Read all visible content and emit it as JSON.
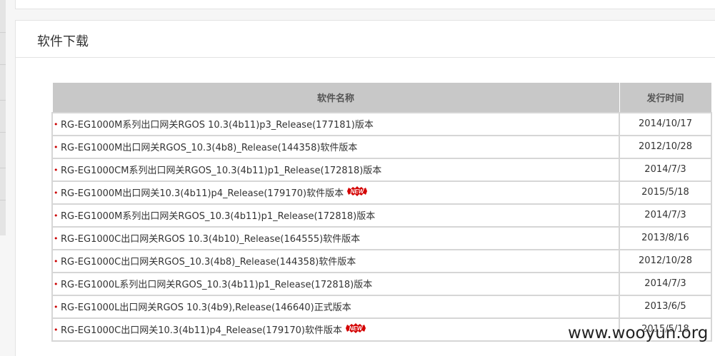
{
  "panel": {
    "title": "软件下载"
  },
  "table": {
    "headers": {
      "name": "软件名称",
      "date": "发行时间"
    },
    "rows": [
      {
        "name": "RG-EG1000M系列出口网关RGOS 10.3(4b11)p3_Release(177181)版本",
        "date": "2014/10/17",
        "is_new": false
      },
      {
        "name": "RG-EG1000M出口网关RGOS_10.3(4b8)_Release(144358)软件版本",
        "date": "2012/10/28",
        "is_new": false
      },
      {
        "name": "RG-EG1000CM系列出口网关RGOS_10.3(4b11)p1_Release(172818)版本",
        "date": "2014/7/3",
        "is_new": false
      },
      {
        "name": "RG-EG1000M出口网关10.3(4b11)p4_Release(179170)软件版本",
        "date": "2015/5/18",
        "is_new": true
      },
      {
        "name": "RG-EG1000M系列出口网关RGOS_10.3(4b11)p1_Release(172818)版本",
        "date": "2014/7/3",
        "is_new": false
      },
      {
        "name": "RG-EG1000C出口网关RGOS 10.3(4b10)_Release(164555)软件版本",
        "date": "2013/8/16",
        "is_new": false
      },
      {
        "name": "RG-EG1000C出口网关RGOS_10.3(4b8)_Release(144358)软件版本",
        "date": "2012/10/28",
        "is_new": false
      },
      {
        "name": "RG-EG1000L系列出口网关RGOS_10.3(4b11)p1_Release(172818)版本",
        "date": "2014/7/3",
        "is_new": false
      },
      {
        "name": "RG-EG1000L出口网关RGOS 10.3(4b9),Release(146640)正式版本",
        "date": "2013/6/5",
        "is_new": false
      },
      {
        "name": "RG-EG1000C出口网关10.3(4b11)p4_Release(179170)软件版本",
        "date": "2015/5/18",
        "is_new": true
      }
    ],
    "new_badge_text": "NEW",
    "bullet_char": "•"
  },
  "watermark": "www.wooyun.org",
  "colors": {
    "header_bg": "#c8c8c8",
    "bullet": "#cc0000",
    "badge": "#d40000"
  }
}
